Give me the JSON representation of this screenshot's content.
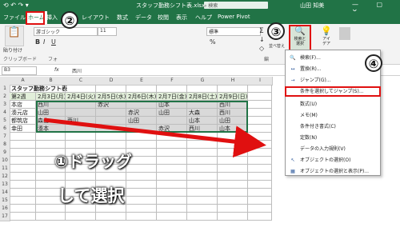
{
  "titlebar": {
    "autosave": "⟲ ↶ ↷ ▾",
    "doc_title": "スタッフ勤務シフト表.xlsx - Excel",
    "search_placeholder": "検索",
    "user": "山田 知美",
    "window_controls": "— ▢ ✕"
  },
  "tabs": [
    "ファイル",
    "ホーム",
    "挿入",
    "ジ",
    "レイアウト",
    "数式",
    "データ",
    "校閲",
    "表示",
    "ヘルプ",
    "Power Pivot"
  ],
  "ribbon": {
    "font_name": "游ゴシック",
    "font_size": "11",
    "number_format": "標準",
    "clipboard_label": "クリップボード",
    "font_group": "フォ",
    "paste": "貼り付け",
    "find_select": "検索と\n選択",
    "ideas": "アイ\nデア",
    "bold": "B",
    "italic": "I",
    "underline": "U",
    "percent": "%",
    "sort_filter": "並べ替え",
    "edit_group": "編",
    "sum": "Σ",
    "fill": "↓",
    "clear": "◇",
    "styles_label": "条件付き\n書式"
  },
  "formula_bar": {
    "cell_ref": "B3",
    "fx": "fx",
    "value": "西川"
  },
  "sheet": {
    "columns": [
      "",
      "A",
      "B",
      "C",
      "D",
      "E",
      "F",
      "G",
      "H",
      "I"
    ],
    "rows": [
      [
        "1",
        "スタッフ勤務シフト表",
        "",
        "",
        "",
        "",
        "",
        "",
        ""
      ],
      [
        "2",
        "第2週",
        "2月3日(月)",
        "2月4日(火)",
        "2月5日(水)",
        "2月6日(木)",
        "2月7日(金)",
        "2月8日(土)",
        "2月9日(日)"
      ],
      [
        "3",
        "本店",
        "西川",
        "",
        "赤沢",
        "",
        "山本",
        "",
        "西川"
      ],
      [
        "4",
        "湊元店",
        "山田",
        "",
        "",
        "赤沢",
        "山田",
        "大森",
        "西川"
      ],
      [
        "5",
        "都筑店",
        "森山",
        "西川",
        "",
        "山田",
        "",
        "山本",
        "山田"
      ],
      [
        "6",
        "幸田",
        "湊本",
        "",
        "",
        "",
        "赤沢",
        "西川",
        "山本"
      ],
      [
        "7",
        "",
        "",
        "",
        "",
        "",
        "",
        "",
        ""
      ],
      [
        "8",
        "",
        "",
        "",
        "",
        "",
        "",
        "",
        ""
      ],
      [
        "9",
        "",
        "",
        "",
        "",
        "",
        "",
        "",
        ""
      ],
      [
        "10",
        "",
        "",
        "",
        "",
        "",
        "",
        "",
        ""
      ],
      [
        "11",
        "",
        "",
        "",
        "",
        "",
        "",
        "",
        ""
      ],
      [
        "12",
        "",
        "",
        "",
        "",
        "",
        "",
        "",
        ""
      ],
      [
        "13",
        "",
        "",
        "",
        "",
        "",
        "",
        "",
        ""
      ],
      [
        "14",
        "",
        "",
        "",
        "",
        "",
        "",
        "",
        ""
      ],
      [
        "15",
        "",
        "",
        "",
        "",
        "",
        "",
        "",
        ""
      ],
      [
        "16",
        "",
        "",
        "",
        "",
        "",
        "",
        "",
        ""
      ],
      [
        "17",
        "",
        "",
        "",
        "",
        "",
        "",
        "",
        ""
      ]
    ]
  },
  "menu": {
    "items": [
      {
        "icon": "🔍",
        "label": "検索(F)..."
      },
      {
        "icon": "↔",
        "label": "置換(R)..."
      },
      {
        "icon": "→",
        "label": "ジャンプ(G)..."
      },
      {
        "icon": "",
        "label": "条件を選択してジャンプ(S)..."
      },
      {
        "icon": "",
        "label": "数式(U)"
      },
      {
        "icon": "",
        "label": "メモ(M)"
      },
      {
        "icon": "",
        "label": "条件付き書式(C)"
      },
      {
        "icon": "",
        "label": "定数(N)"
      },
      {
        "icon": "",
        "label": "データの入力規則(V)"
      },
      {
        "icon": "↖",
        "label": "オブジェクトの選択(O)"
      },
      {
        "icon": "▦",
        "label": "オブジェクトの選択と表示(P)..."
      }
    ]
  },
  "annotations": {
    "n1": "①ドラッグ",
    "n1b": "して選択",
    "n2": "②",
    "n3": "③",
    "n4": "④"
  },
  "colors": {
    "excel_green": "#217346",
    "highlight": "#e01010",
    "header_fill": "#e2efda"
  }
}
